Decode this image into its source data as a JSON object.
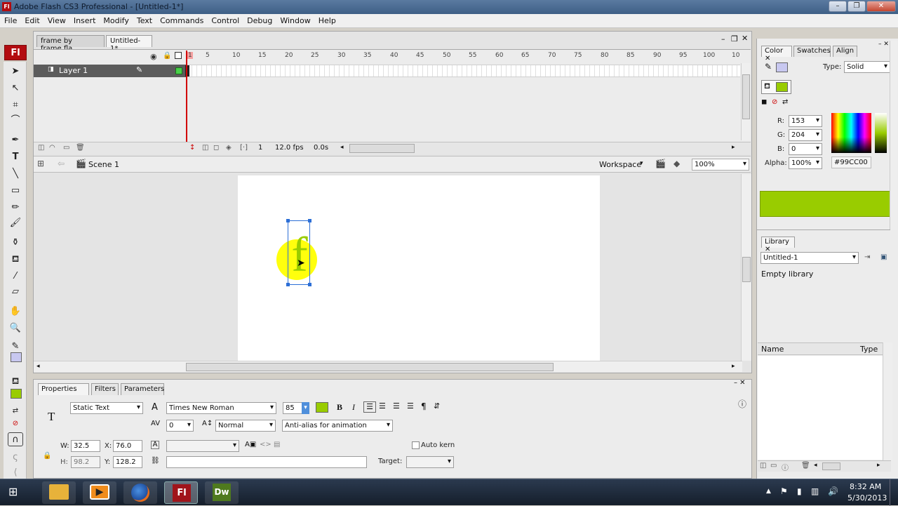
{
  "window": {
    "title": "Adobe Flash CS3 Professional - [Untitled-1*]",
    "app_icon": "Fl",
    "controls": [
      "–",
      "❐",
      "✕"
    ]
  },
  "menu": [
    "File",
    "Edit",
    "View",
    "Insert",
    "Modify",
    "Text",
    "Commands",
    "Control",
    "Debug",
    "Window",
    "Help"
  ],
  "doc_tabs": [
    "frame by frame.fla",
    "Untitled-1*"
  ],
  "doc_controls": [
    "–",
    "❐",
    "✕"
  ],
  "timeline": {
    "ruler": [
      "1",
      "5",
      "10",
      "15",
      "20",
      "25",
      "30",
      "35",
      "40",
      "45",
      "50",
      "55",
      "60",
      "65",
      "70",
      "75",
      "80",
      "85",
      "90",
      "95",
      "100",
      "10"
    ],
    "layer_name": "Layer 1",
    "current_frame": "1",
    "fps": "12.0 fps",
    "elapsed": "0.0s"
  },
  "editbar": {
    "scene": "Scene 1",
    "workspace": "Workspace",
    "zoom": "100%"
  },
  "stage": {
    "text_char": "f",
    "text_color": "#99CC00",
    "highlight_color": "#ffff00"
  },
  "properties": {
    "tabs": [
      "Properties",
      "Filters",
      "Parameters"
    ],
    "text_type": "Static Text",
    "font": "Times New Roman",
    "font_size": "85",
    "text_fill": "#99cc00",
    "bold": "B",
    "italic": "I",
    "letter_spacing": "0",
    "char_position": "Normal",
    "anti_alias": "Anti-alias for animation",
    "w_label": "W:",
    "w": "32.5",
    "x_label": "X:",
    "x": "76.0",
    "h_label": "H:",
    "h": "98.2",
    "y_label": "Y:",
    "y": "128.2",
    "auto_kern": "Auto kern",
    "target_label": "Target:"
  },
  "color_panel": {
    "tabs": [
      "Color",
      "Swatches",
      "Align"
    ],
    "type_label": "Type:",
    "type": "Solid",
    "r_label": "R:",
    "r": "153",
    "g_label": "G:",
    "g": "204",
    "b_label": "B:",
    "b": "0",
    "alpha_label": "Alpha:",
    "alpha": "100%",
    "hex": "#99CC00",
    "stroke_color": "#c8c8f0",
    "fill_color": "#99cc00"
  },
  "library_panel": {
    "tab": "Library",
    "doc": "Untitled-1",
    "status": "Empty library",
    "col_name": "Name",
    "col_type": "Type"
  },
  "taskbar": {
    "time": "8:32 AM",
    "date": "5/30/2013",
    "apps": [
      "Fl",
      "Dw"
    ]
  }
}
